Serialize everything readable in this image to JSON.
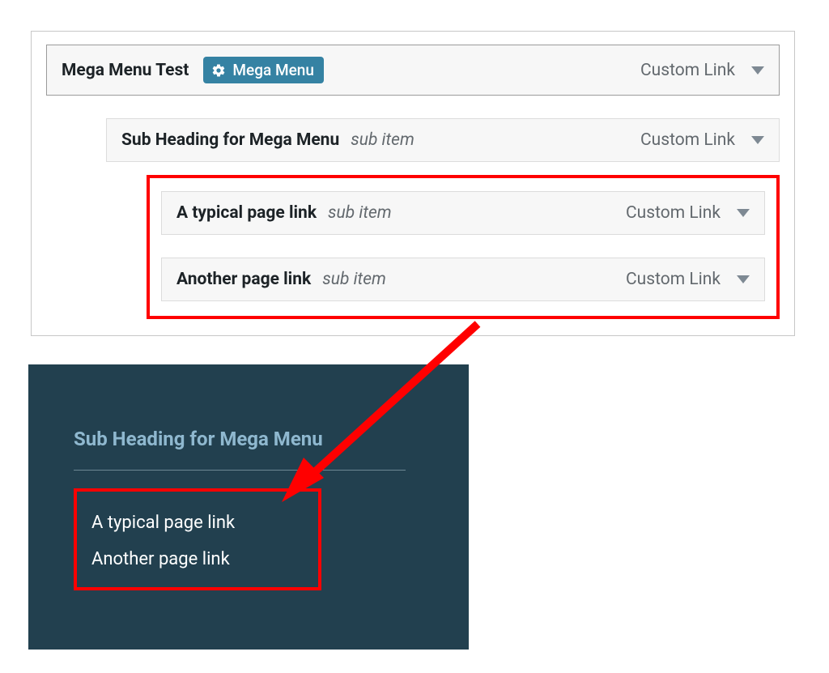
{
  "menu": {
    "root": {
      "title": "Mega Menu Test",
      "badge": "Mega Menu",
      "type": "Custom Link"
    },
    "sub_label": "sub item",
    "level1": {
      "title": "Sub Heading for Mega Menu",
      "type": "Custom Link"
    },
    "level2": [
      {
        "title": "A typical page link",
        "type": "Custom Link"
      },
      {
        "title": "Another page link",
        "type": "Custom Link"
      }
    ]
  },
  "preview": {
    "heading": "Sub Heading for Mega Menu",
    "links": [
      "A typical page link",
      "Another page link"
    ]
  }
}
